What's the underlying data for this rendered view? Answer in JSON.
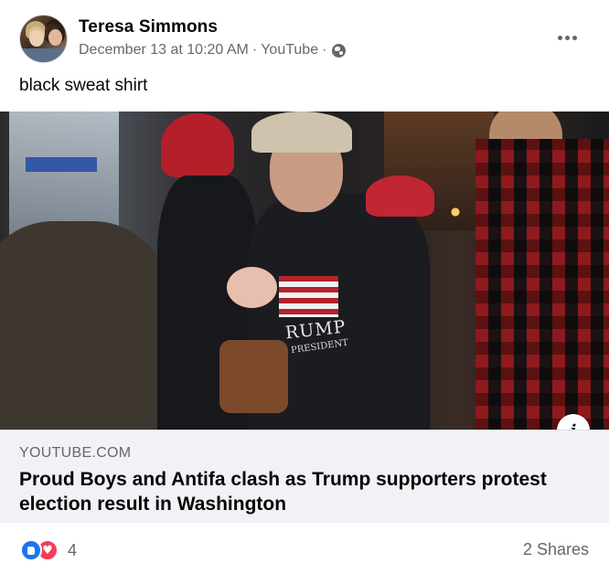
{
  "post": {
    "author": "Teresa Simmons",
    "date": "December 13 at 10:20 AM",
    "separator": "·",
    "source": "YouTube",
    "privacy_icon": "globe-icon",
    "more_icon": "more-options-icon",
    "text": "black sweat shirt"
  },
  "link": {
    "shirt_text": "RUMP",
    "shirt_sub": "PRESIDENT",
    "info_icon": "i",
    "domain": "YOUTUBE.COM",
    "title": "Proud Boys and Antifa clash as Trump supporters protest election result in Washington"
  },
  "footer": {
    "reaction_icons": [
      "like-icon",
      "love-icon"
    ],
    "love_glyph": "♥",
    "reaction_count": "4",
    "shares": "2 Shares"
  },
  "colors": {
    "like": "#1877f2",
    "love": "#f33e58",
    "link_bg": "#f0f2f5",
    "secondary_text": "#65676b"
  }
}
